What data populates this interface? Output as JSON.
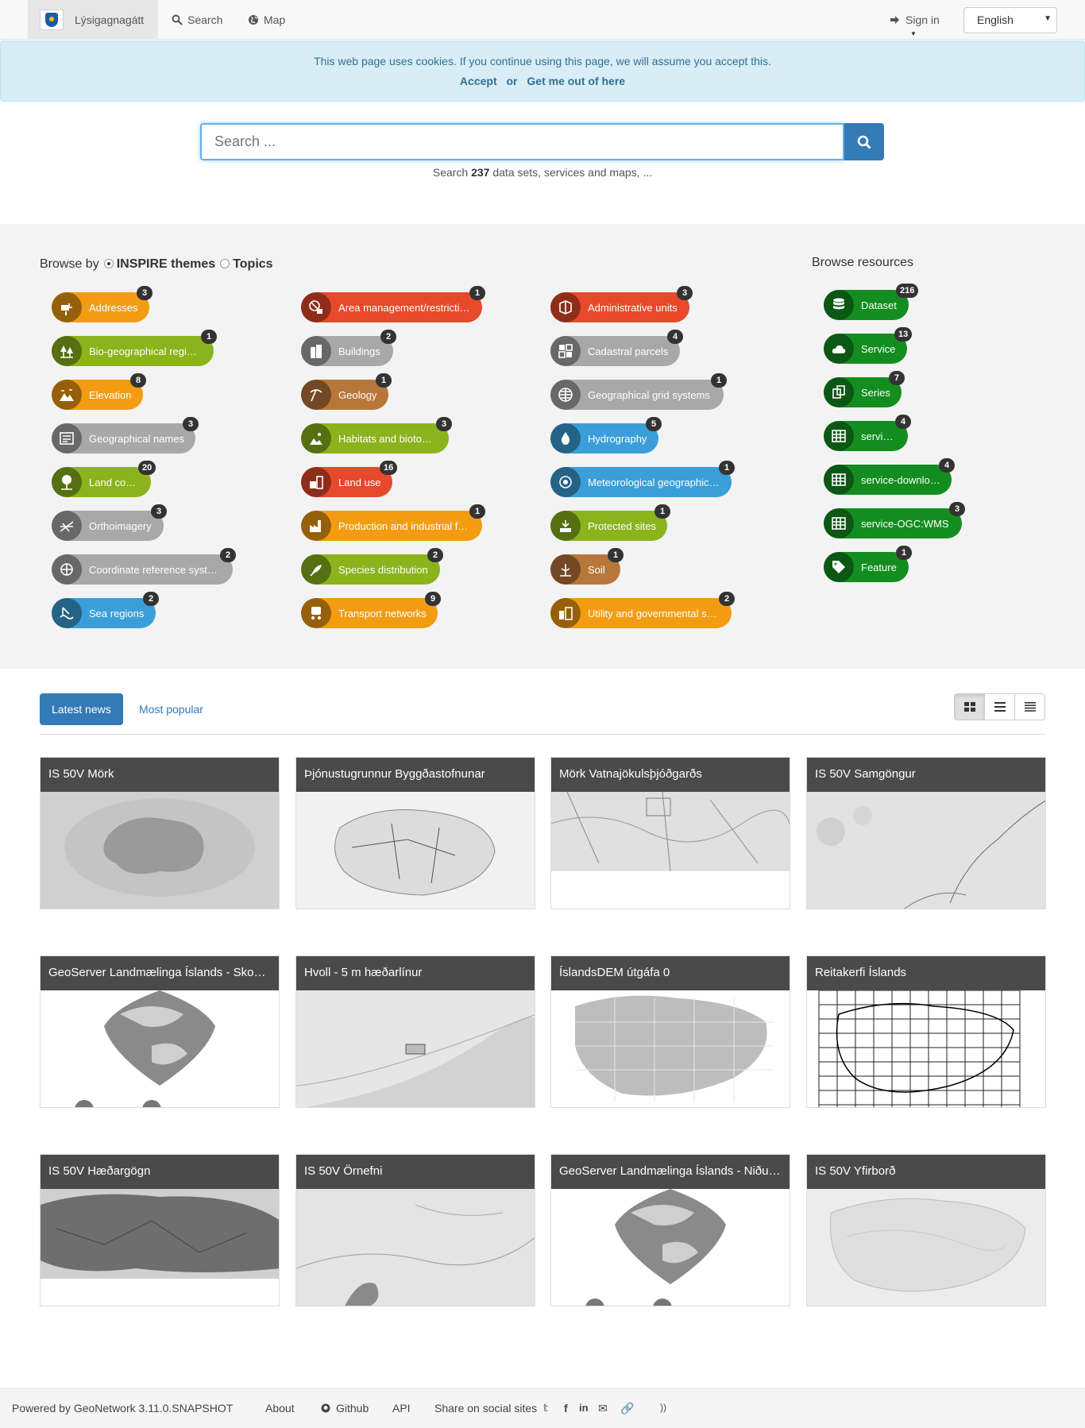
{
  "navbar": {
    "brand": "Lýsigagnagátt",
    "search_label": "Search",
    "map_label": "Map",
    "signin_label": "Sign in",
    "language": "English"
  },
  "cookie": {
    "message": "This web page uses cookies. If you continue using this page, we will assume you accept this.",
    "accept": "Accept",
    "or": "or",
    "leave": "Get me out of here"
  },
  "search": {
    "placeholder": "Search ...",
    "stat_prefix": "Search",
    "stat_count": "237",
    "stat_suffix": "data sets, services and maps, ..."
  },
  "browse": {
    "title": "Browse by",
    "option_inspire": "INSPIRE themes",
    "option_topics": "Topics",
    "selected": "INSPIRE themes",
    "resources_title": "Browse resources"
  },
  "themes": [
    {
      "label": "Addresses",
      "count": "3",
      "color": "#f39c12",
      "icon": "mailbox-icon"
    },
    {
      "label": "Bio-geographical regions",
      "count": "1",
      "color": "#8bb31c",
      "icon": "trees-icon"
    },
    {
      "label": "Elevation",
      "count": "8",
      "color": "#f39c12",
      "icon": "mountain-icon"
    },
    {
      "label": "Geographical names",
      "count": "3",
      "color": "#a8a8a8",
      "icon": "names-icon"
    },
    {
      "label": "Land cover",
      "count": "20",
      "color": "#8bb31c",
      "icon": "tree-icon"
    },
    {
      "label": "Orthoimagery",
      "count": "3",
      "color": "#a8a8a8",
      "icon": "satellite-icon"
    },
    {
      "label": "Coordinate reference systems",
      "count": "2",
      "color": "#a8a8a8",
      "icon": "compass-icon"
    },
    {
      "label": "Sea regions",
      "count": "2",
      "color": "#3a9fd8",
      "icon": "wave-icon"
    },
    {
      "label": "Area management/restriction/regulation zones",
      "count": "1",
      "color": "#e8492b",
      "icon": "restriction-icon"
    },
    {
      "label": "Buildings",
      "count": "2",
      "color": "#a8a8a8",
      "icon": "building-icon"
    },
    {
      "label": "Geology",
      "count": "1",
      "color": "#b8773a",
      "icon": "pickaxe-icon"
    },
    {
      "label": "Habitats and biotopes",
      "count": "3",
      "color": "#8bb31c",
      "icon": "habitat-icon"
    },
    {
      "label": "Land use",
      "count": "16",
      "color": "#e8492b",
      "icon": "landuse-icon"
    },
    {
      "label": "Production and industrial facilities",
      "count": "1",
      "color": "#f39c12",
      "icon": "factory-icon"
    },
    {
      "label": "Species distribution",
      "count": "2",
      "color": "#8bb31c",
      "icon": "species-icon"
    },
    {
      "label": "Transport networks",
      "count": "9",
      "color": "#f39c12",
      "icon": "transport-icon"
    },
    {
      "label": "Administrative units",
      "count": "3",
      "color": "#e8492b",
      "icon": "admin-icon"
    },
    {
      "label": "Cadastral parcels",
      "count": "4",
      "color": "#a8a8a8",
      "icon": "parcel-icon"
    },
    {
      "label": "Geographical grid systems",
      "count": "1",
      "color": "#a8a8a8",
      "icon": "globe-grid-icon"
    },
    {
      "label": "Hydrography",
      "count": "5",
      "color": "#3a9fd8",
      "icon": "water-drop-icon"
    },
    {
      "label": "Meteorological geographical features",
      "count": "1",
      "color": "#3a9fd8",
      "icon": "weather-icon"
    },
    {
      "label": "Protected sites",
      "count": "1",
      "color": "#8bb31c",
      "icon": "protected-icon"
    },
    {
      "label": "Soil",
      "count": "1",
      "color": "#b8773a",
      "icon": "soil-icon"
    },
    {
      "label": "Utility and governmental services",
      "count": "2",
      "color": "#f39c12",
      "icon": "utility-icon"
    }
  ],
  "resources": [
    {
      "label": "Dataset",
      "count": "216",
      "icon": "database-icon"
    },
    {
      "label": "Service",
      "count": "13",
      "icon": "cloud-icon"
    },
    {
      "label": "Series",
      "count": "7",
      "icon": "copy-icon"
    },
    {
      "label": "service-view",
      "count": "4",
      "icon": "table-icon"
    },
    {
      "label": "service-download",
      "count": "4",
      "icon": "table-icon"
    },
    {
      "label": "service-OGC:WMS",
      "count": "3",
      "icon": "table-icon"
    },
    {
      "label": "Feature",
      "count": "1",
      "icon": "tag-icon"
    }
  ],
  "news": {
    "tab_latest": "Latest news",
    "tab_popular": "Most popular",
    "active_tab": "Latest news"
  },
  "cards": [
    {
      "title": "IS 50V Mörk"
    },
    {
      "title": "Þjónustugrunnur Byggðastofnunar"
    },
    {
      "title": "Mörk Vatnajökulsþjóðgarðs"
    },
    {
      "title": "IS 50V Samgöngur"
    },
    {
      "title": "GeoServer Landmælinga Íslands - Skoðunarþjónusta"
    },
    {
      "title": "Hvoll - 5 m hæðarlínur"
    },
    {
      "title": "ÍslandsDEM útgáfa 0"
    },
    {
      "title": "Reitakerfi Íslands"
    },
    {
      "title": "IS 50V Hæðargögn"
    },
    {
      "title": "IS 50V Örnefni"
    },
    {
      "title": "GeoServer Landmælinga Íslands - Niðurhalsþjónusta"
    },
    {
      "title": "IS 50V Yfirborð"
    }
  ],
  "footer": {
    "powered": "Powered by GeoNetwork 3.11.0.SNAPSHOT",
    "about": "About",
    "github": "Github",
    "api": "API",
    "share": "Share on social sites"
  },
  "colors": {
    "primary": "#337ab7",
    "resource_green": "#138d1f",
    "navbar_bg": "#f8f8f8",
    "cookie_bg": "#d9edf7"
  }
}
